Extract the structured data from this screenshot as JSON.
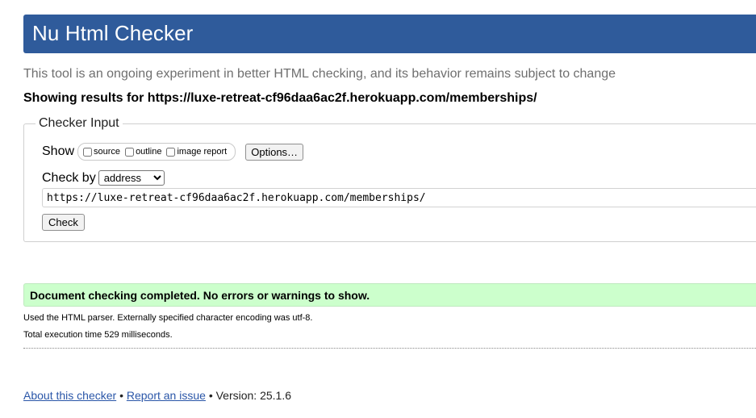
{
  "header": {
    "title": "Nu Html Checker"
  },
  "intro_text": "This tool is an ongoing experiment in better HTML checking, and its behavior remains subject to change",
  "showing_results": "Showing results for https://luxe-retreat-cf96daa6ac2f.herokuapp.com/memberships/",
  "checker_input": {
    "legend": "Checker Input",
    "show_label": "Show",
    "show_options": [
      {
        "label": "source",
        "checked": false
      },
      {
        "label": "outline",
        "checked": false
      },
      {
        "label": "image report",
        "checked": false
      }
    ],
    "options_button": "Options…",
    "check_by_label": "Check by",
    "check_by_selected": "address",
    "url_value": "https://luxe-retreat-cf96daa6ac2f.herokuapp.com/memberships/",
    "check_button": "Check"
  },
  "result": {
    "status_message": "Document checking completed. No errors or warnings to show.",
    "parser_info": "Used the HTML parser. Externally specified character encoding was utf-8.",
    "execution_time": "Total execution time 529 milliseconds."
  },
  "footer": {
    "about_link": "About this checker",
    "separator": "•",
    "report_link": "Report an issue",
    "version_text": "Version: 25.1.6"
  },
  "colors": {
    "header_bg": "#2f5b9b",
    "success_bg": "#ccffcc",
    "link": "#2a56a8"
  }
}
